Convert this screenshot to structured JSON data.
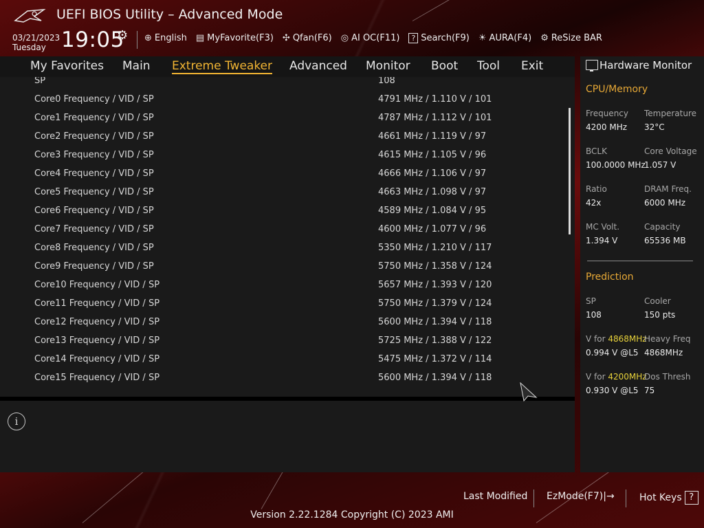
{
  "header": {
    "title": "UEFI BIOS Utility – Advanced Mode",
    "date": "03/21/2023",
    "weekday": "Tuesday",
    "time": "19:05"
  },
  "toolbar": [
    {
      "icon": "globe-icon",
      "glyph": "⊕",
      "label": "English"
    },
    {
      "icon": "favorite-icon",
      "glyph": "▤",
      "label": "MyFavorite(F3)"
    },
    {
      "icon": "fan-icon",
      "glyph": "✣",
      "label": "Qfan(F6)"
    },
    {
      "icon": "ai-oc-icon",
      "glyph": "◎",
      "label": "AI OC(F11)"
    },
    {
      "icon": "search-icon",
      "glyph": "?",
      "label": "Search(F9)"
    },
    {
      "icon": "aura-icon",
      "glyph": "☀",
      "label": "AURA(F4)"
    },
    {
      "icon": "resize-bar-icon",
      "glyph": "⚙",
      "label": "ReSize BAR"
    }
  ],
  "menu": [
    "My Favorites",
    "Main",
    "Extreme Tweaker",
    "Advanced",
    "Monitor",
    "Boot",
    "Tool",
    "Exit"
  ],
  "active_menu": "Extreme Tweaker",
  "settings": [
    {
      "label": "SP",
      "value": "108"
    },
    {
      "label": "Core0 Frequency / VID / SP",
      "value": "4791 MHz / 1.110 V / 101"
    },
    {
      "label": "Core1 Frequency / VID / SP",
      "value": "4787 MHz / 1.112 V / 101"
    },
    {
      "label": "Core2 Frequency / VID / SP",
      "value": "4661 MHz / 1.119 V / 97"
    },
    {
      "label": "Core3 Frequency / VID / SP",
      "value": "4615 MHz / 1.105 V / 96"
    },
    {
      "label": "Core4 Frequency / VID / SP",
      "value": "4666 MHz / 1.106 V / 97"
    },
    {
      "label": "Core5 Frequency / VID / SP",
      "value": "4663 MHz / 1.098 V / 97"
    },
    {
      "label": "Core6 Frequency / VID / SP",
      "value": "4589 MHz / 1.084 V / 95"
    },
    {
      "label": "Core7 Frequency / VID / SP",
      "value": "4600 MHz / 1.077 V / 96"
    },
    {
      "label": "Core8 Frequency / VID / SP",
      "value": "5350 MHz / 1.210 V / 117"
    },
    {
      "label": "Core9 Frequency / VID / SP",
      "value": "5750 MHz / 1.358 V / 124"
    },
    {
      "label": "Core10 Frequency / VID / SP",
      "value": "5657 MHz / 1.393 V / 120"
    },
    {
      "label": "Core11 Frequency / VID / SP",
      "value": "5750 MHz / 1.379 V / 124"
    },
    {
      "label": "Core12 Frequency / VID / SP",
      "value": "5600 MHz / 1.394 V / 118"
    },
    {
      "label": "Core13 Frequency / VID / SP",
      "value": "5725 MHz / 1.388 V / 122"
    },
    {
      "label": "Core14 Frequency / VID / SP",
      "value": "5475 MHz / 1.372 V / 114"
    },
    {
      "label": "Core15 Frequency / VID / SP",
      "value": "5600 MHz / 1.394 V / 118"
    }
  ],
  "hardware_monitor": {
    "title": "Hardware Monitor",
    "cpu_memory": {
      "heading": "CPU/Memory",
      "frequency_label": "Frequency",
      "frequency": "4200 MHz",
      "temperature_label": "Temperature",
      "temperature": "32°C",
      "bclk_label": "BCLK",
      "bclk": "100.0000 MHz",
      "core_voltage_label": "Core Voltage",
      "core_voltage": "1.057 V",
      "ratio_label": "Ratio",
      "ratio": "42x",
      "dram_freq_label": "DRAM Freq.",
      "dram_freq": "6000 MHz",
      "mc_volt_label": "MC Volt.",
      "mc_volt": "1.394 V",
      "capacity_label": "Capacity",
      "capacity": "65536 MB"
    },
    "prediction": {
      "heading": "Prediction",
      "sp_label": "SP",
      "sp": "108",
      "cooler_label": "Cooler",
      "cooler": "150 pts",
      "v_for_1_prefix": "V for ",
      "v_for_1_freq": "4868MHz",
      "v_for_1": "0.994 V @L5",
      "heavy_freq_label": "Heavy Freq",
      "heavy_freq": "4868MHz",
      "v_for_2_prefix": "V for ",
      "v_for_2_freq": "4200MHz",
      "v_for_2": "0.930 V @L5",
      "dos_thresh_label": "Dos Thresh",
      "dos_thresh": "75"
    }
  },
  "footer": {
    "last_modified": "Last Modified",
    "ezmode": "EzMode(F7)|→",
    "hot_keys": "Hot Keys",
    "hot_keys_key": "?",
    "version": "Version 2.22.1284 Copyright (C) 2023 AMI"
  },
  "colors": {
    "accent": "#f2b533",
    "highlight": "#e8d23a",
    "panel": "#1a1a1a"
  }
}
